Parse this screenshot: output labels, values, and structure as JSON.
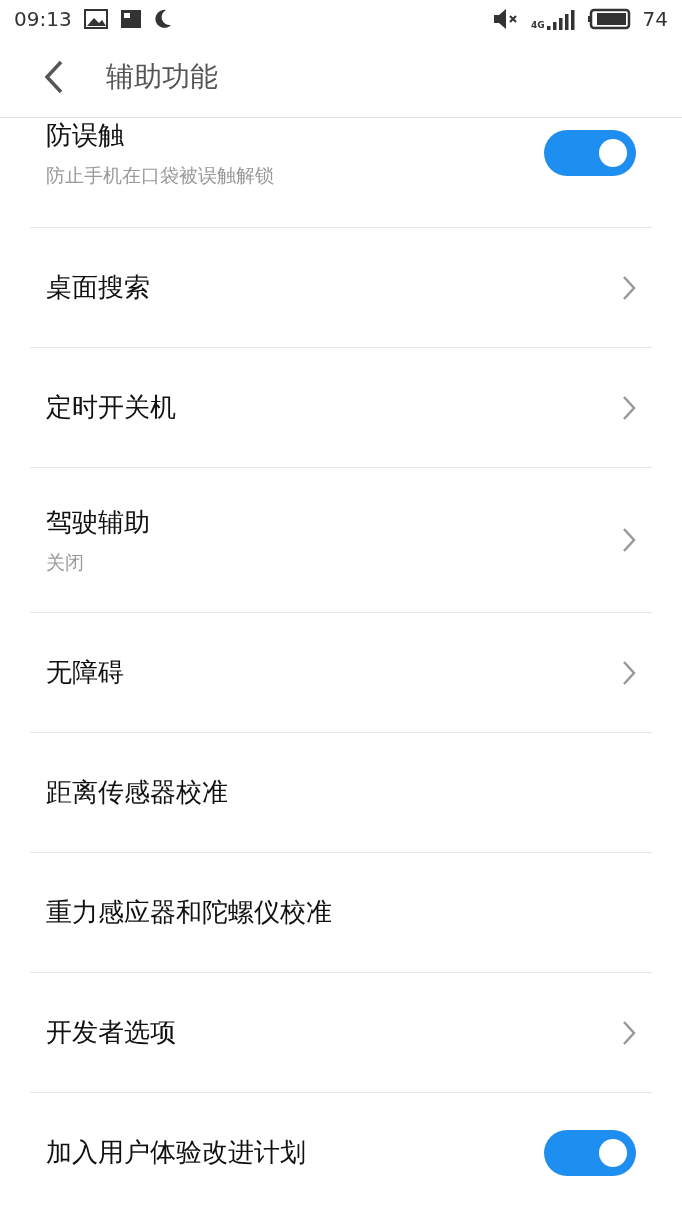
{
  "status_bar": {
    "time": "09:13",
    "network": "4G",
    "battery": "74"
  },
  "header": {
    "title": "辅助功能"
  },
  "items": [
    {
      "kind": "toggle",
      "title": "防误触",
      "subtitle": "防止手机在口袋被误触解锁",
      "on": true
    },
    {
      "kind": "nav",
      "title": "桌面搜索"
    },
    {
      "kind": "nav",
      "title": "定时开关机"
    },
    {
      "kind": "nav",
      "title": "驾驶辅助",
      "subtitle": "关闭"
    },
    {
      "kind": "nav",
      "title": "无障碍"
    },
    {
      "kind": "plain",
      "title": "距离传感器校准"
    },
    {
      "kind": "plain",
      "title": "重力感应器和陀螺仪校准"
    },
    {
      "kind": "nav",
      "title": "开发者选项"
    },
    {
      "kind": "toggle",
      "title": "加入用户体验改进计划",
      "on": true
    }
  ]
}
